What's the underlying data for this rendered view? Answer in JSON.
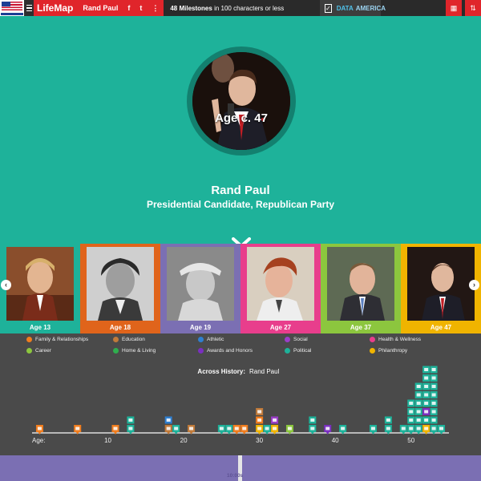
{
  "topbar": {
    "brand": "LifeMap",
    "person": "Rand Paul",
    "social": [
      "f",
      "t",
      "⋮"
    ],
    "milestones_bold": "48 Milestones",
    "milestones_rest": "in 100 characters or less",
    "data_america_1": "DATA",
    "data_america_2": "AMERICA"
  },
  "hero": {
    "age_label": "Age c. 47",
    "name": "Rand Paul",
    "title": "Presidential Candidate, Republican Party"
  },
  "ages": [
    {
      "label": "Age 13",
      "color": "#1eb29a"
    },
    {
      "label": "Age 18",
      "color": "#e0641b"
    },
    {
      "label": "Age 19",
      "color": "#7b6fb3"
    },
    {
      "label": "Age 27",
      "color": "#e83e8c"
    },
    {
      "label": "Age 37",
      "color": "#8cc63e"
    },
    {
      "label": "Age 47",
      "color": "#f0b400"
    }
  ],
  "legend": [
    {
      "label": "Family & Relationships",
      "color": "#f07d1e"
    },
    {
      "label": "Education",
      "color": "#c07a3a"
    },
    {
      "label": "Athletic",
      "color": "#2f7fd0"
    },
    {
      "label": "Social",
      "color": "#9b3ec8"
    },
    {
      "label": "Health & Wellness",
      "color": "#e83e8c"
    },
    {
      "label": "Career",
      "color": "#8cc63e"
    },
    {
      "label": "Home & Living",
      "color": "#2fae4e"
    },
    {
      "label": "Awards and Honors",
      "color": "#7a2fc0"
    },
    {
      "label": "Political",
      "color": "#1eb29a"
    },
    {
      "label": "Philanthropy",
      "color": "#f0b400"
    }
  ],
  "chart_data": {
    "type": "scatter",
    "title": "Across History:",
    "subtitle": "Rand Paul",
    "xlabel": "Age:",
    "xticks": [
      10,
      20,
      30,
      40,
      50
    ],
    "xlim": [
      0,
      55
    ],
    "stacks": [
      {
        "age": 1,
        "cats": [
          "family"
        ]
      },
      {
        "age": 6,
        "cats": [
          "family"
        ]
      },
      {
        "age": 11,
        "cats": [
          "family"
        ]
      },
      {
        "age": 13,
        "cats": [
          "political",
          "political"
        ]
      },
      {
        "age": 18,
        "cats": [
          "education",
          "athletic"
        ]
      },
      {
        "age": 19,
        "cats": [
          "political"
        ]
      },
      {
        "age": 21,
        "cats": [
          "education"
        ]
      },
      {
        "age": 25,
        "cats": [
          "political"
        ]
      },
      {
        "age": 26,
        "cats": [
          "political"
        ]
      },
      {
        "age": 27,
        "cats": [
          "family"
        ]
      },
      {
        "age": 28,
        "cats": [
          "family"
        ]
      },
      {
        "age": 30,
        "cats": [
          "philanthropy",
          "family",
          "education"
        ]
      },
      {
        "age": 31,
        "cats": [
          "political"
        ]
      },
      {
        "age": 32,
        "cats": [
          "philanthropy",
          "social"
        ]
      },
      {
        "age": 34,
        "cats": [
          "career"
        ]
      },
      {
        "age": 37,
        "cats": [
          "political",
          "political"
        ]
      },
      {
        "age": 39,
        "cats": [
          "awards"
        ]
      },
      {
        "age": 41,
        "cats": [
          "political"
        ]
      },
      {
        "age": 45,
        "cats": [
          "political"
        ]
      },
      {
        "age": 47,
        "cats": [
          "political",
          "political"
        ]
      },
      {
        "age": 49,
        "cats": [
          "political"
        ]
      },
      {
        "age": 50,
        "cats": [
          "political",
          "political",
          "political",
          "political"
        ]
      },
      {
        "age": 51,
        "cats": [
          "political",
          "political",
          "political",
          "political",
          "political",
          "political"
        ]
      },
      {
        "age": 52,
        "cats": [
          "philanthropy",
          "political",
          "awards",
          "political",
          "political",
          "political",
          "political",
          "political"
        ]
      },
      {
        "age": 53,
        "cats": [
          "political",
          "political",
          "political",
          "political",
          "political",
          "political",
          "political",
          "political"
        ]
      },
      {
        "age": 54,
        "cats": [
          "political"
        ]
      }
    ]
  },
  "footer": {
    "decade_label": "10:00s"
  }
}
